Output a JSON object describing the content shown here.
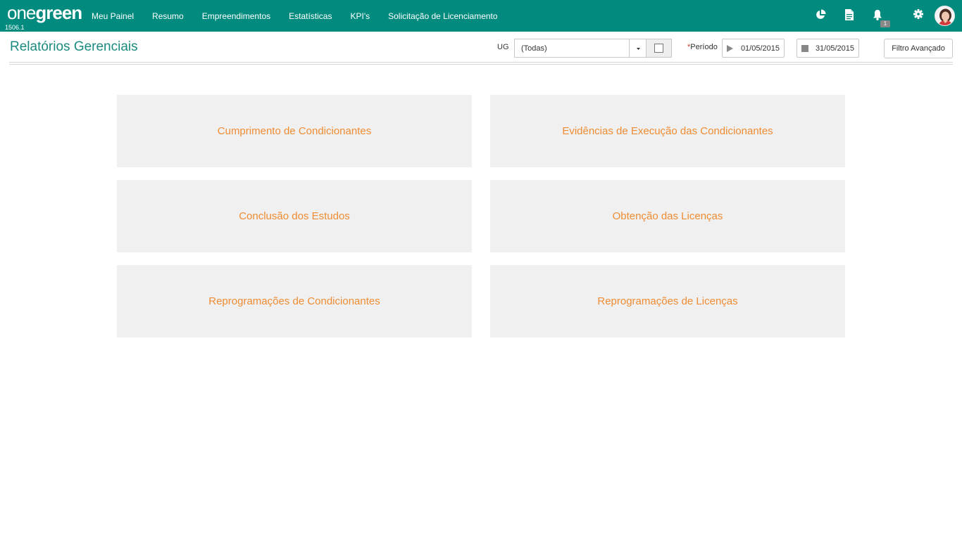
{
  "app": {
    "logo_one": "one",
    "logo_green": "green",
    "version": "1506.1",
    "brand_color": "#008b7e"
  },
  "nav": {
    "items": [
      {
        "label": "Meu Painel"
      },
      {
        "label": "Resumo"
      },
      {
        "label": "Empreendimentos"
      },
      {
        "label": "Estatísticas"
      },
      {
        "label": "KPI's"
      },
      {
        "label": "Solicitação de Licenciamento"
      }
    ]
  },
  "top_icons": {
    "icons": [
      "pie-chart-icon",
      "document-icon",
      "bell-icon",
      "gear-icon"
    ],
    "notification_count": "1"
  },
  "page": {
    "title": "Relatórios Gerenciais"
  },
  "filters": {
    "ug_label": "UG",
    "ug_value": "(Todas)",
    "periodo_required_mark": "*",
    "periodo_label": "Período",
    "start_date": "01/05/2015",
    "end_date": "31/05/2015",
    "advanced_filter_label": "Filtro Avançado"
  },
  "reports": {
    "accent_color": "#ef8c33",
    "tiles": [
      {
        "label": "Cumprimento de Condicionantes"
      },
      {
        "label": "Evidências de Execução das Condicionantes"
      },
      {
        "label": "Conclusão dos Estudos"
      },
      {
        "label": "Obtenção das Licenças"
      },
      {
        "label": "Reprogramações de Condicionantes"
      },
      {
        "label": "Reprogramações de Licenças"
      }
    ]
  }
}
